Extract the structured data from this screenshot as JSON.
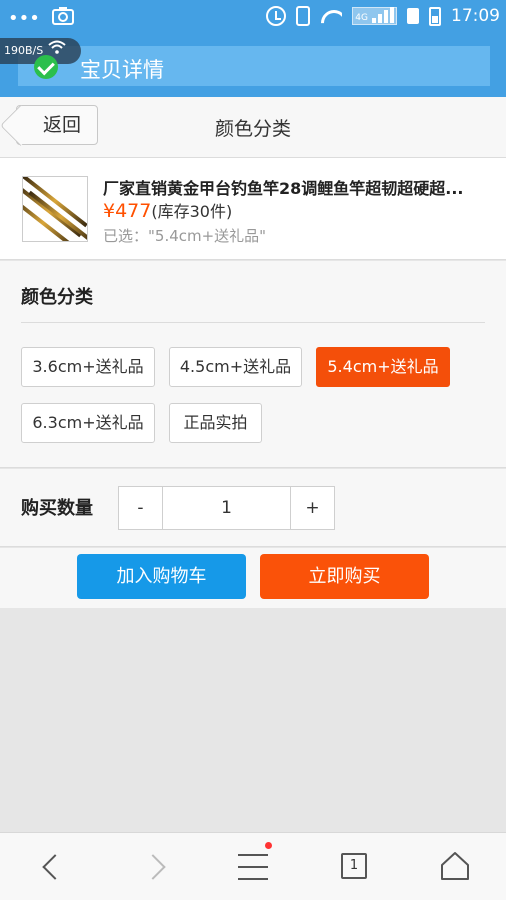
{
  "status_bar": {
    "time": "17:09",
    "network_type": "4G",
    "speed": "190B/S"
  },
  "header": {
    "title": "宝贝详情"
  },
  "nav": {
    "back_label": "返回",
    "title": "颜色分类"
  },
  "product": {
    "title": "厂家直销黄金甲台钓鱼竿28调鲤鱼竿超韧超硬超...",
    "price": "¥477",
    "stock": "(库存30件)",
    "selected": "已选：\"5.4cm+送礼品\""
  },
  "color_section": {
    "label": "颜色分类",
    "options": [
      {
        "label": "3.6cm+送礼品",
        "selected": false
      },
      {
        "label": "4.5cm+送礼品",
        "selected": false
      },
      {
        "label": "5.4cm+送礼品",
        "selected": true
      },
      {
        "label": "6.3cm+送礼品",
        "selected": false
      },
      {
        "label": "正品实拍",
        "selected": false
      }
    ]
  },
  "quantity": {
    "label": "购买数量",
    "minus": "-",
    "value": "1",
    "plus": "+"
  },
  "actions": {
    "add_to_cart": "加入购物车",
    "buy_now": "立即购买"
  },
  "bottom_bar": {
    "tab_count": "1",
    "has_notification": true
  },
  "colors": {
    "header_blue": "#43a0e3",
    "accent_orange": "#fa5209",
    "cart_blue": "#1699e8",
    "price_orange": "#ff5000"
  }
}
